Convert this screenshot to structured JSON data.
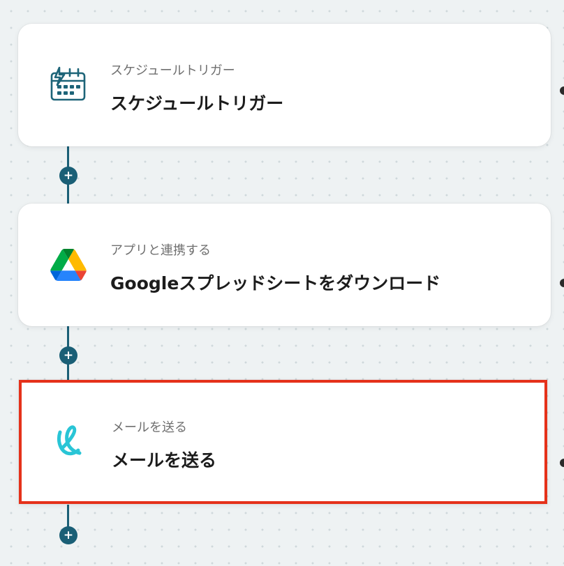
{
  "canvas": {
    "add_step_symbol": "+"
  },
  "steps": [
    {
      "subtitle": "スケジュールトリガー",
      "title": "スケジュールトリガー",
      "icon": "schedule-trigger-icon",
      "selected": false
    },
    {
      "subtitle": "アプリと連携する",
      "title": "Googleスプレッドシートをダウンロード",
      "icon": "google-drive-icon",
      "selected": false
    },
    {
      "subtitle": "メールを送る",
      "title": "メールを送る",
      "icon": "yoom-mail-icon",
      "selected": true
    }
  ],
  "colors": {
    "connector": "#1a5f76",
    "selection_border": "#e5311a",
    "schedule_icon": "#1d6478",
    "mail_icon": "#29c5d6"
  }
}
